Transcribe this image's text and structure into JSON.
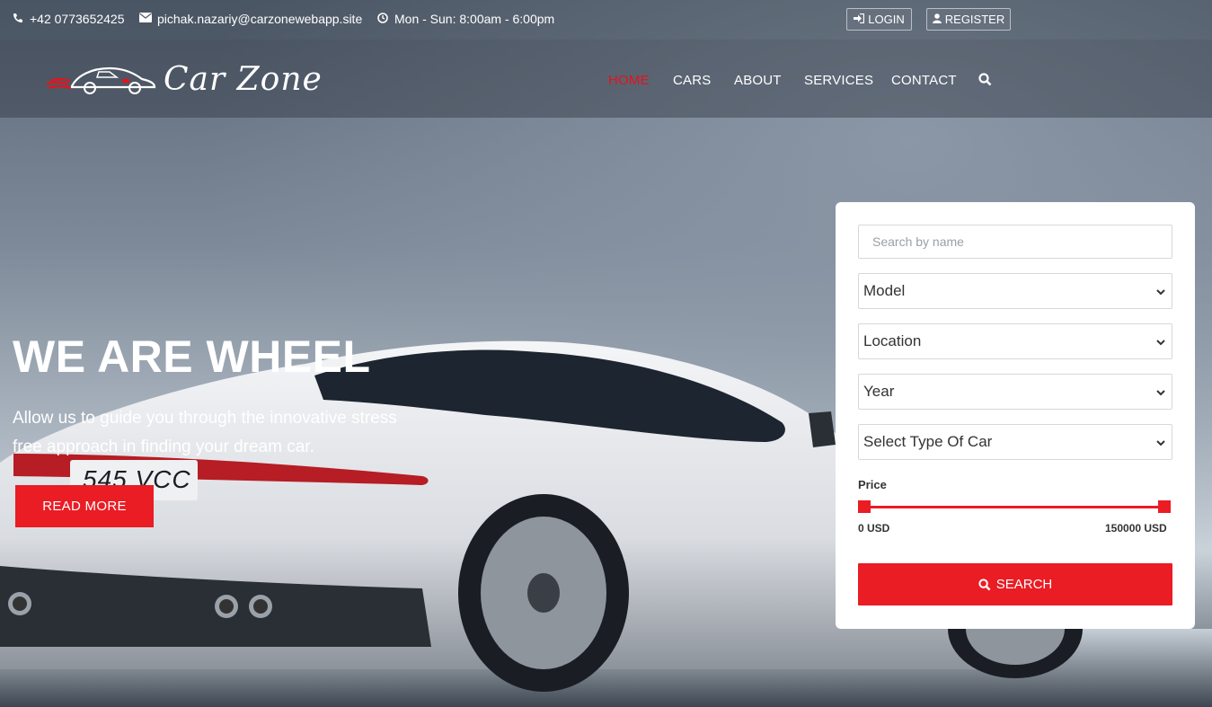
{
  "topbar": {
    "phone": "+42 0773652425",
    "email": "pichak.nazariy@carzonewebapp.site",
    "hours": "Mon - Sun: 8:00am - 6:00pm",
    "login_label": "LOGIN",
    "register_label": "REGISTER",
    "icons": {
      "phone": "phone-icon",
      "email": "envelope-icon",
      "hours": "clock-icon",
      "login": "sign-in-icon",
      "register": "user-icon"
    }
  },
  "brand": {
    "name": "Car Zone"
  },
  "nav": {
    "items": [
      {
        "label": "HOME",
        "active": true
      },
      {
        "label": "CARS",
        "active": false
      },
      {
        "label": "ABOUT",
        "active": false
      },
      {
        "label": "SERVICES",
        "active": false
      },
      {
        "label": "CONTACT",
        "active": false
      }
    ],
    "search_icon": "search-icon"
  },
  "hero": {
    "title": "WE ARE WHEEL",
    "subtitle": "Allow us to guide you through the innovative stress free approach in finding your dream car.",
    "cta_label": "READ MORE",
    "plate": "545 VCC"
  },
  "search_panel": {
    "name_placeholder": "Search by name",
    "model_selected": "Model",
    "location_selected": "Location",
    "year_selected": "Year",
    "type_selected": "Select Type Of Car",
    "price_label": "Price",
    "price_min": "0 USD",
    "price_max": "150000 USD",
    "search_label": "SEARCH"
  },
  "colors": {
    "accent": "#ea1c24",
    "panel_bg": "#ffffff",
    "text_light": "#ffffff"
  }
}
